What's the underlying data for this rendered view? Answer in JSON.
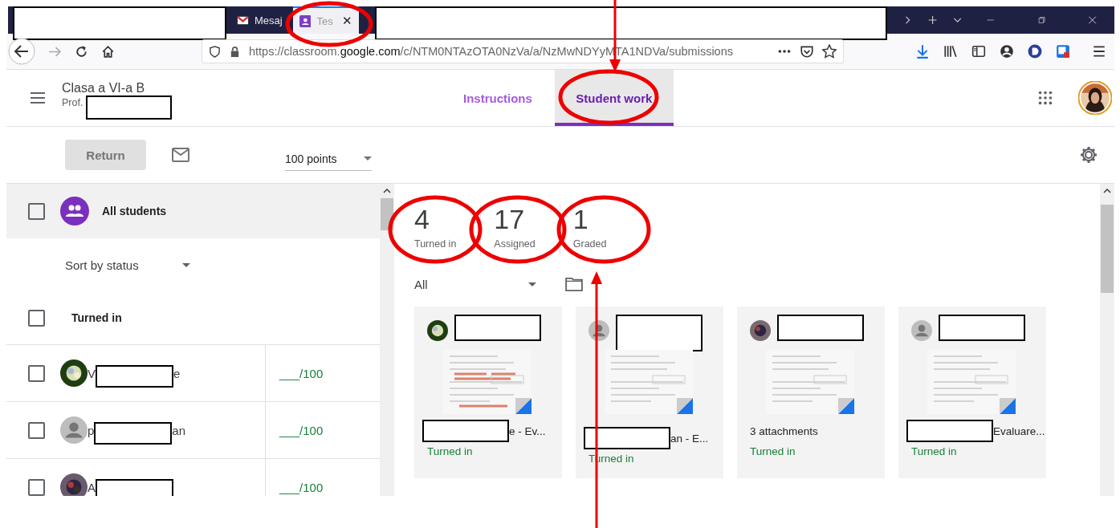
{
  "browser": {
    "tabs": [
      {
        "title": "Mesaj",
        "kind": "mail",
        "selected": false
      },
      {
        "title": "Tes",
        "kind": "classroom",
        "selected": true
      }
    ],
    "close_glyph": "✕",
    "url": {
      "prefix": "https://classroom.",
      "domain": "google.com",
      "path": "/c/NTM0NTAzOTA0NzVa/a/NzMwNDYyMTA1NDVa/submissions"
    }
  },
  "app": {
    "class_name": "Clasa a VI-a B",
    "teacher_prefix": "Prof.",
    "tabs": [
      {
        "label": "Instructions",
        "selected": false
      },
      {
        "label": "Student work",
        "selected": true
      }
    ]
  },
  "toolbar": {
    "return_label": "Return",
    "return_disabled": true,
    "points": "100 points"
  },
  "roster": {
    "all_label": "All students",
    "all_checked": false,
    "sort_label": "Sort by status",
    "group_label": "Turned in",
    "group_checked": false,
    "students": [
      {
        "name_start": "V",
        "name_end": "e",
        "has_photo": true,
        "grade": "___/100",
        "checked": false
      },
      {
        "name_start": "p",
        "name_end": "an",
        "has_photo": false,
        "grade": "___/100",
        "checked": false
      },
      {
        "name_start": "A",
        "has_photo": true,
        "grade": "___/100",
        "checked": false
      }
    ]
  },
  "stats": [
    {
      "value": "4",
      "label": "Turned in"
    },
    {
      "value": "17",
      "label": "Assigned"
    },
    {
      "value": "1",
      "label": "Graded"
    }
  ],
  "filter": "All",
  "cards": [
    {
      "has_photo": true,
      "title": "e - Ev...",
      "status": "Turned in",
      "redacted": true
    },
    {
      "has_photo": false,
      "title": "an - E...",
      "status": "Turned in",
      "redacted": true
    },
    {
      "has_photo": true,
      "title": "3 attachments",
      "status": "Turned in",
      "redacted": false
    },
    {
      "has_photo": false,
      "title": "Evaluare...",
      "status": "Turned in",
      "redacted": true
    }
  ]
}
